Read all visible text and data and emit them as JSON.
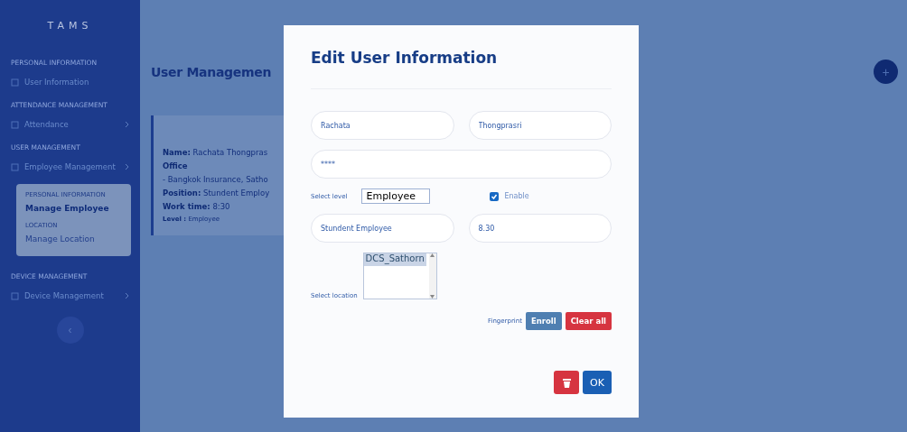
{
  "sidebar": {
    "logo": "TAMS",
    "sections": [
      {
        "header": "PERSONAL INFORMATION",
        "items": [
          {
            "label": "User Information",
            "has_arrow": false
          }
        ]
      },
      {
        "header": "ATTENDANCE MANAGEMENT",
        "items": [
          {
            "label": "Attendance",
            "has_arrow": true
          }
        ]
      },
      {
        "header": "USER MANAGEMENT",
        "items": [
          {
            "label": "Employee Management",
            "has_arrow": true,
            "expanded": true,
            "submenu": [
              {
                "header": "PERSONAL INFORMATION",
                "label": "Manage Employee",
                "selected": true
              },
              {
                "header": "LOCATION",
                "label": "Manage Location",
                "selected": false
              }
            ]
          }
        ]
      },
      {
        "header": "DEVICE MANAGEMENT",
        "items": [
          {
            "label": "Device Management",
            "has_arrow": true
          }
        ]
      }
    ],
    "collapse": "‹"
  },
  "page_title": "User Managemen",
  "add_button": "+",
  "card": {
    "name_label": "Name:",
    "name": "Rachata Thongpras",
    "office_label": "Office",
    "office": "- Bangkok Insurance, Satho",
    "position_label": "Position:",
    "position": "Stundent Employ",
    "worktime_label": "Work time:",
    "worktime": "8:30",
    "level_label": "Level :",
    "level": "Employee"
  },
  "modal": {
    "title": "Edit User Information",
    "first_name": "Rachata",
    "last_name": "Thongprasri",
    "password": "****",
    "level_label": "Select level",
    "level_value": "Employee",
    "enable_label": "Enable",
    "enable_checked": true,
    "position": "Stundent Employee",
    "work_time": "8.30",
    "location_label": "Select location",
    "locations": [
      {
        "label": "DCS_Sathorn",
        "selected": true
      }
    ],
    "fingerprint_label": "Fingerprint",
    "enroll": "Enroll",
    "clear": "Clear all",
    "ok": "OK"
  }
}
